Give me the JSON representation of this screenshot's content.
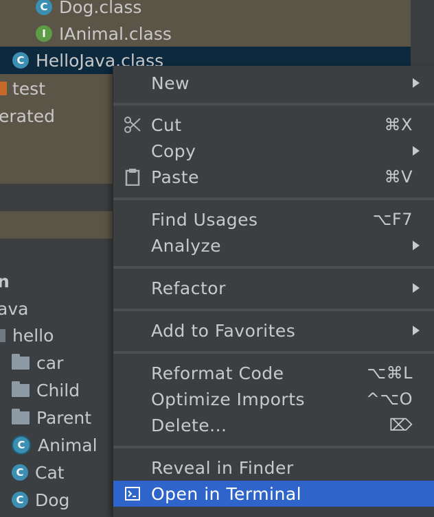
{
  "project_tree": {
    "rows": [
      {
        "label": "Dog.class",
        "icon": "class-icon"
      },
      {
        "label": "IAnimal.class",
        "icon": "interface-icon"
      },
      {
        "label": "HelloJava.class",
        "icon": "class-icon"
      },
      {
        "label": "test",
        "icon": "test-folder-icon"
      },
      {
        "label": "erated",
        "icon": ""
      },
      {
        "label": "n",
        "icon": ""
      },
      {
        "label": "ava",
        "icon": ""
      },
      {
        "label": "hello",
        "icon": "package-icon"
      },
      {
        "label": "car",
        "icon": "package-icon"
      },
      {
        "label": "Child",
        "icon": "package-icon"
      },
      {
        "label": "Parent",
        "icon": "package-icon"
      },
      {
        "label": "Animal",
        "icon": "abstract-class-icon"
      },
      {
        "label": "Cat",
        "icon": "class-icon"
      },
      {
        "label": "Dog",
        "icon": "class-icon"
      }
    ],
    "icon_letters": {
      "class": "C",
      "interface": "I"
    }
  },
  "context_menu": {
    "new": "New",
    "cut": "Cut",
    "cut_shortcut": "⌘X",
    "copy": "Copy",
    "paste": "Paste",
    "paste_shortcut": "⌘V",
    "find_usages": "Find Usages",
    "find_usages_shortcut": "⌥F7",
    "analyze": "Analyze",
    "refactor": "Refactor",
    "add_to_favorites": "Add to Favorites",
    "reformat_code": "Reformat Code",
    "reformat_code_shortcut": "⌥⌘L",
    "optimize_imports": "Optimize Imports",
    "optimize_imports_shortcut": "^⌥O",
    "delete": "Delete...",
    "delete_shortcut": "⌦",
    "reveal_in_finder": "Reveal in Finder",
    "open_in_terminal": "Open in Terminal",
    "highlighted_item": "Open in Terminal"
  },
  "colors": {
    "background": "#3c3f41",
    "selection": "#0d293e",
    "menu_highlight": "#2f65ca",
    "class_icon": "#3b8fb3",
    "interface_icon": "#5d9b47"
  }
}
